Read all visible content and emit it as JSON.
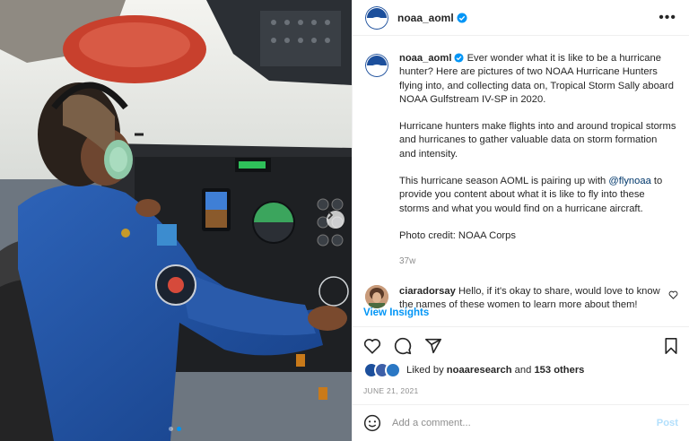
{
  "header": {
    "username": "noaa_aoml",
    "more_label": "•••"
  },
  "caption": {
    "username": "noaa_aoml",
    "paragraph1": "Ever wonder what it is like to be a hurricane hunter? Here are pictures of two NOAA Hurricane Hunters flying into, and collecting data on, Tropical Storm Sally aboard NOAA Gulfstream IV-SP in 2020.",
    "paragraph2": "Hurricane hunters make flights into and around tropical storms and hurricanes to gather valuable data on storm formation and intensity.",
    "paragraph3_before": "This hurricane season AOML is pairing up with ",
    "paragraph3_mention": "@flynoaa",
    "paragraph3_after": " to provide you content about what it is like to fly into these storms and what you would find on a hurricane aircraft.",
    "paragraph4": "Photo credit: NOAA Corps",
    "age": "37w"
  },
  "comment": {
    "username": "ciaradorsay",
    "text": "Hello, if it's okay to share, would love to know the names of these women to learn more about them!"
  },
  "insights_label": "View Insights",
  "likes": {
    "prefix": "Liked by",
    "user": "noaaresearch",
    "joiner": "and",
    "others": "153 others"
  },
  "date": "JUNE 21, 2021",
  "add_comment": {
    "placeholder": "Add a comment...",
    "post_label": "Post"
  },
  "carousel": {
    "total": 2,
    "current": 2
  },
  "colors": {
    "accent": "#0095f6",
    "post_disabled": "#b2dffc",
    "noaa_blue": "#1c4f9c"
  }
}
